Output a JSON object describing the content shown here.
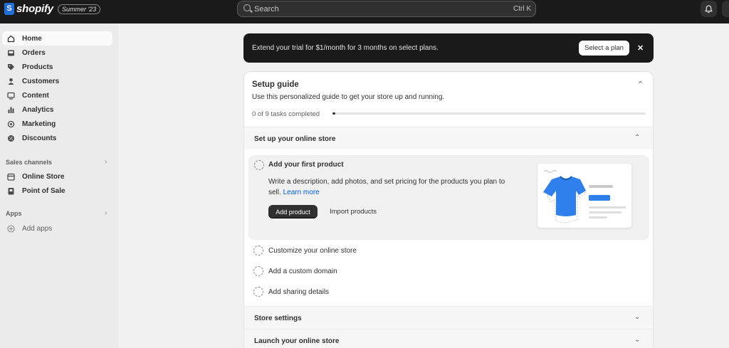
{
  "topbar": {
    "brand": "shopify",
    "edition": "Summer '23",
    "search_placeholder": "Search",
    "search_shortcut": "Ctrl K"
  },
  "sidebar": {
    "items": [
      {
        "label": "Home",
        "icon": "home-icon",
        "active": true
      },
      {
        "label": "Orders",
        "icon": "inbox-icon"
      },
      {
        "label": "Products",
        "icon": "tag-icon"
      },
      {
        "label": "Customers",
        "icon": "person-icon"
      },
      {
        "label": "Content",
        "icon": "content-icon"
      },
      {
        "label": "Analytics",
        "icon": "bar-chart-icon"
      },
      {
        "label": "Marketing",
        "icon": "target-icon"
      },
      {
        "label": "Discounts",
        "icon": "discount-icon"
      }
    ],
    "sales_channels_label": "Sales channels",
    "channels": [
      {
        "label": "Online Store",
        "icon": "store-icon"
      },
      {
        "label": "Point of Sale",
        "icon": "pos-icon"
      }
    ],
    "apps_label": "Apps",
    "add_apps_label": "Add apps"
  },
  "banner": {
    "text": "Extend your trial for $1/month for 3 months on select plans.",
    "button_label": "Select a plan",
    "close_label": "✕"
  },
  "setup_guide": {
    "title": "Setup guide",
    "subtitle": "Use this personalized guide to get your store up and running.",
    "progress_text": "0 of 9 tasks completed",
    "progress_fraction": 0.0,
    "section_online_store": "Set up your online store",
    "expanded_task": {
      "title": "Add your first product",
      "description": "Write a description, add photos, and set pricing for the products you plan to sell.",
      "link": "Learn more",
      "primary_button": "Add product",
      "secondary_button": "Import products"
    },
    "tasks": [
      "Customize your online store",
      "Add a custom domain",
      "Add sharing details"
    ],
    "section_store_settings": "Store settings",
    "section_launch": "Launch your online store"
  },
  "colors": {
    "topbar": "#1a1a1a",
    "accent": "#005bd3",
    "tshirt": "#2f80ed"
  }
}
